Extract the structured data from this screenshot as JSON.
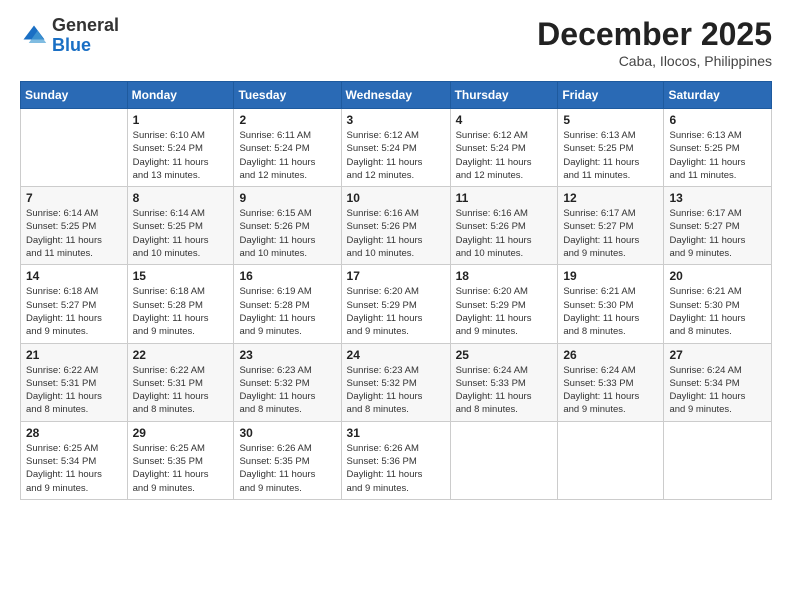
{
  "logo": {
    "general": "General",
    "blue": "Blue"
  },
  "header": {
    "month": "December 2025",
    "location": "Caba, Ilocos, Philippines"
  },
  "weekdays": [
    "Sunday",
    "Monday",
    "Tuesday",
    "Wednesday",
    "Thursday",
    "Friday",
    "Saturday"
  ],
  "weeks": [
    [
      {
        "day": "",
        "info": ""
      },
      {
        "day": "1",
        "info": "Sunrise: 6:10 AM\nSunset: 5:24 PM\nDaylight: 11 hours\nand 13 minutes."
      },
      {
        "day": "2",
        "info": "Sunrise: 6:11 AM\nSunset: 5:24 PM\nDaylight: 11 hours\nand 12 minutes."
      },
      {
        "day": "3",
        "info": "Sunrise: 6:12 AM\nSunset: 5:24 PM\nDaylight: 11 hours\nand 12 minutes."
      },
      {
        "day": "4",
        "info": "Sunrise: 6:12 AM\nSunset: 5:24 PM\nDaylight: 11 hours\nand 12 minutes."
      },
      {
        "day": "5",
        "info": "Sunrise: 6:13 AM\nSunset: 5:25 PM\nDaylight: 11 hours\nand 11 minutes."
      },
      {
        "day": "6",
        "info": "Sunrise: 6:13 AM\nSunset: 5:25 PM\nDaylight: 11 hours\nand 11 minutes."
      }
    ],
    [
      {
        "day": "7",
        "info": "Sunrise: 6:14 AM\nSunset: 5:25 PM\nDaylight: 11 hours\nand 11 minutes."
      },
      {
        "day": "8",
        "info": "Sunrise: 6:14 AM\nSunset: 5:25 PM\nDaylight: 11 hours\nand 10 minutes."
      },
      {
        "day": "9",
        "info": "Sunrise: 6:15 AM\nSunset: 5:26 PM\nDaylight: 11 hours\nand 10 minutes."
      },
      {
        "day": "10",
        "info": "Sunrise: 6:16 AM\nSunset: 5:26 PM\nDaylight: 11 hours\nand 10 minutes."
      },
      {
        "day": "11",
        "info": "Sunrise: 6:16 AM\nSunset: 5:26 PM\nDaylight: 11 hours\nand 10 minutes."
      },
      {
        "day": "12",
        "info": "Sunrise: 6:17 AM\nSunset: 5:27 PM\nDaylight: 11 hours\nand 9 minutes."
      },
      {
        "day": "13",
        "info": "Sunrise: 6:17 AM\nSunset: 5:27 PM\nDaylight: 11 hours\nand 9 minutes."
      }
    ],
    [
      {
        "day": "14",
        "info": "Sunrise: 6:18 AM\nSunset: 5:27 PM\nDaylight: 11 hours\nand 9 minutes."
      },
      {
        "day": "15",
        "info": "Sunrise: 6:18 AM\nSunset: 5:28 PM\nDaylight: 11 hours\nand 9 minutes."
      },
      {
        "day": "16",
        "info": "Sunrise: 6:19 AM\nSunset: 5:28 PM\nDaylight: 11 hours\nand 9 minutes."
      },
      {
        "day": "17",
        "info": "Sunrise: 6:20 AM\nSunset: 5:29 PM\nDaylight: 11 hours\nand 9 minutes."
      },
      {
        "day": "18",
        "info": "Sunrise: 6:20 AM\nSunset: 5:29 PM\nDaylight: 11 hours\nand 9 minutes."
      },
      {
        "day": "19",
        "info": "Sunrise: 6:21 AM\nSunset: 5:30 PM\nDaylight: 11 hours\nand 8 minutes."
      },
      {
        "day": "20",
        "info": "Sunrise: 6:21 AM\nSunset: 5:30 PM\nDaylight: 11 hours\nand 8 minutes."
      }
    ],
    [
      {
        "day": "21",
        "info": "Sunrise: 6:22 AM\nSunset: 5:31 PM\nDaylight: 11 hours\nand 8 minutes."
      },
      {
        "day": "22",
        "info": "Sunrise: 6:22 AM\nSunset: 5:31 PM\nDaylight: 11 hours\nand 8 minutes."
      },
      {
        "day": "23",
        "info": "Sunrise: 6:23 AM\nSunset: 5:32 PM\nDaylight: 11 hours\nand 8 minutes."
      },
      {
        "day": "24",
        "info": "Sunrise: 6:23 AM\nSunset: 5:32 PM\nDaylight: 11 hours\nand 8 minutes."
      },
      {
        "day": "25",
        "info": "Sunrise: 6:24 AM\nSunset: 5:33 PM\nDaylight: 11 hours\nand 8 minutes."
      },
      {
        "day": "26",
        "info": "Sunrise: 6:24 AM\nSunset: 5:33 PM\nDaylight: 11 hours\nand 9 minutes."
      },
      {
        "day": "27",
        "info": "Sunrise: 6:24 AM\nSunset: 5:34 PM\nDaylight: 11 hours\nand 9 minutes."
      }
    ],
    [
      {
        "day": "28",
        "info": "Sunrise: 6:25 AM\nSunset: 5:34 PM\nDaylight: 11 hours\nand 9 minutes."
      },
      {
        "day": "29",
        "info": "Sunrise: 6:25 AM\nSunset: 5:35 PM\nDaylight: 11 hours\nand 9 minutes."
      },
      {
        "day": "30",
        "info": "Sunrise: 6:26 AM\nSunset: 5:35 PM\nDaylight: 11 hours\nand 9 minutes."
      },
      {
        "day": "31",
        "info": "Sunrise: 6:26 AM\nSunset: 5:36 PM\nDaylight: 11 hours\nand 9 minutes."
      },
      {
        "day": "",
        "info": ""
      },
      {
        "day": "",
        "info": ""
      },
      {
        "day": "",
        "info": ""
      }
    ]
  ]
}
